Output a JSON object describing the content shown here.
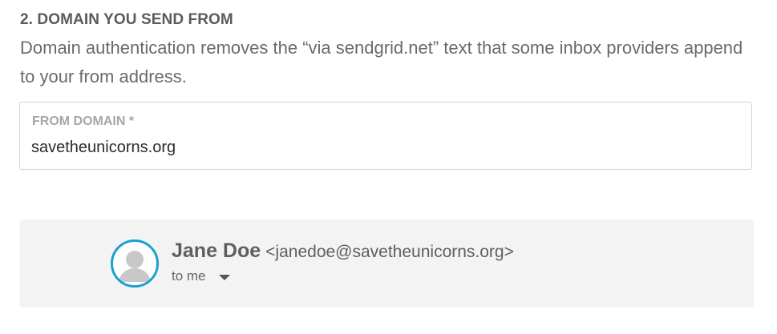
{
  "section": {
    "title": "2. DOMAIN YOU SEND FROM",
    "description": "Domain authentication removes the “via sendgrid.net” text that some inbox providers append to your from address."
  },
  "from_domain": {
    "label": "FROM DOMAIN *",
    "value": "savetheunicorns.org"
  },
  "preview": {
    "sender_name": "Jane Doe",
    "sender_email": "<janedoe@savetheunicorns.org>",
    "recipient_text": "to me",
    "avatar_icon": "person-avatar-icon",
    "avatar_ring_color": "#1a9fd1"
  }
}
